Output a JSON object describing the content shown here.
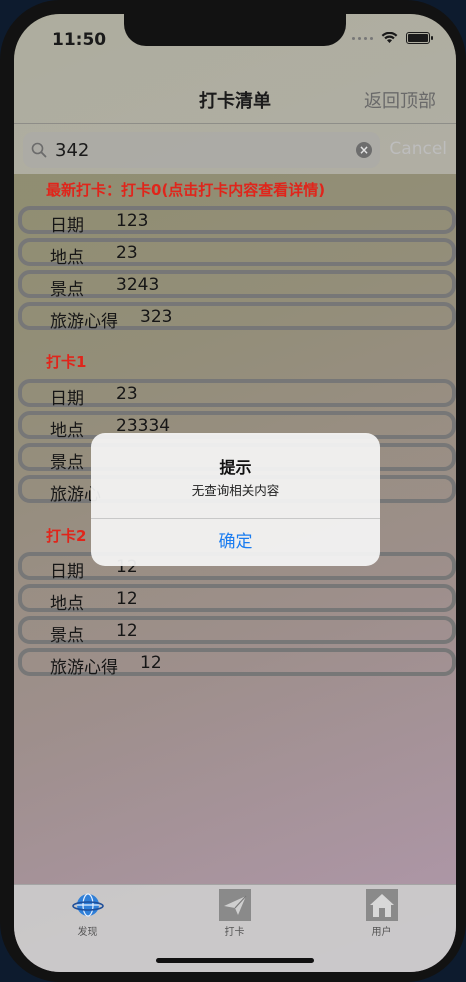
{
  "status_bar": {
    "time": "11:50"
  },
  "nav": {
    "title": "打卡清单",
    "right_button": "返回顶部"
  },
  "search": {
    "value": "342",
    "cancel_label": "Cancel"
  },
  "sections": [
    {
      "title": "最新打卡：打卡0(点击打卡内容查看详情)",
      "rows": [
        {
          "label": "日期",
          "value": "123"
        },
        {
          "label": "地点",
          "value": "23"
        },
        {
          "label": "景点",
          "value": "3243"
        },
        {
          "label": "旅游心得",
          "value": "323"
        }
      ]
    },
    {
      "title": "打卡1",
      "rows": [
        {
          "label": "日期",
          "value": "23"
        },
        {
          "label": "地点",
          "value": "23334"
        },
        {
          "label": "景点",
          "value": ""
        },
        {
          "label": "旅游心",
          "value": ""
        }
      ]
    },
    {
      "title": "打卡2",
      "rows": [
        {
          "label": "日期",
          "value": "12"
        },
        {
          "label": "地点",
          "value": "12"
        },
        {
          "label": "景点",
          "value": "12"
        },
        {
          "label": "旅游心得",
          "value": "12"
        }
      ]
    }
  ],
  "alert": {
    "title": "提示",
    "message": "无查询相关内容",
    "button": "确定"
  },
  "tabs": [
    {
      "label": "发现",
      "icon": "globe-icon"
    },
    {
      "label": "打卡",
      "icon": "send-icon"
    },
    {
      "label": "用户",
      "icon": "home-icon"
    }
  ],
  "colors": {
    "section_title": "#e0251b",
    "alert_button": "#1a7cf0"
  }
}
